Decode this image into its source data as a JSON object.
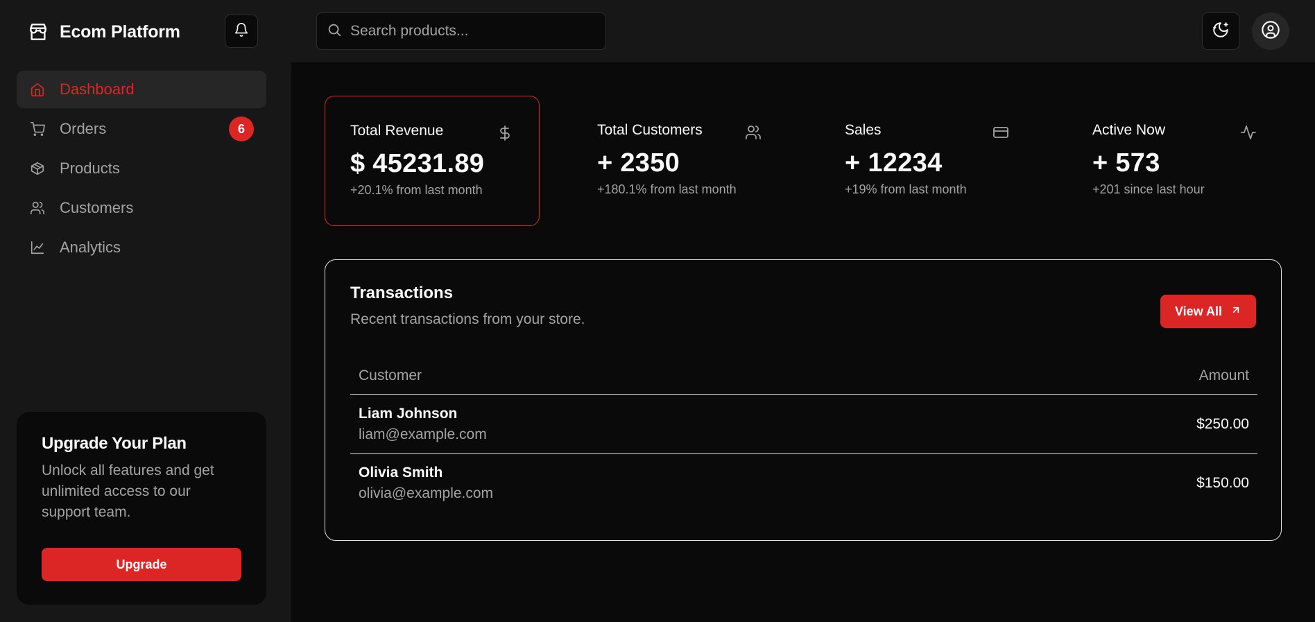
{
  "brand": {
    "title": "Ecom Platform",
    "icon": "store-icon"
  },
  "sidebar": {
    "items": [
      {
        "label": "Dashboard",
        "icon": "home-icon",
        "active": true
      },
      {
        "label": "Orders",
        "icon": "cart-icon",
        "badge": "6"
      },
      {
        "label": "Products",
        "icon": "package-icon"
      },
      {
        "label": "Customers",
        "icon": "users-icon"
      },
      {
        "label": "Analytics",
        "icon": "line-chart-icon"
      }
    ],
    "upgrade": {
      "title": "Upgrade Your Plan",
      "text": "Unlock all features and get unlimited access to our support team.",
      "button": "Upgrade"
    }
  },
  "topbar": {
    "search_placeholder": "Search products...",
    "theme_icon": "moon-stars-icon",
    "user_icon": "user-circle-icon"
  },
  "stats": [
    {
      "label": "Total Revenue",
      "value": "$ 45231.89",
      "change": "+20.1% from last month",
      "icon": "dollar-icon"
    },
    {
      "label": "Total Customers",
      "value": "+ 2350",
      "change": "+180.1% from last month",
      "icon": "users-icon"
    },
    {
      "label": "Sales",
      "value": "+ 12234",
      "change": "+19% from last month",
      "icon": "credit-card-icon"
    },
    {
      "label": "Active Now",
      "value": "+ 573",
      "change": "+201 since last hour",
      "icon": "activity-icon"
    }
  ],
  "transactions": {
    "title": "Transactions",
    "subtitle": "Recent transactions from your store.",
    "view_all": "View All",
    "columns": {
      "customer": "Customer",
      "amount": "Amount"
    },
    "rows": [
      {
        "name": "Liam Johnson",
        "email": "liam@example.com",
        "amount": "$250.00"
      },
      {
        "name": "Olivia Smith",
        "email": "olivia@example.com",
        "amount": "$150.00"
      }
    ]
  },
  "colors": {
    "accent": "#dc2626",
    "background": "#0a0a0a",
    "sidebar": "#171717",
    "muted": "#a3a3a3"
  }
}
